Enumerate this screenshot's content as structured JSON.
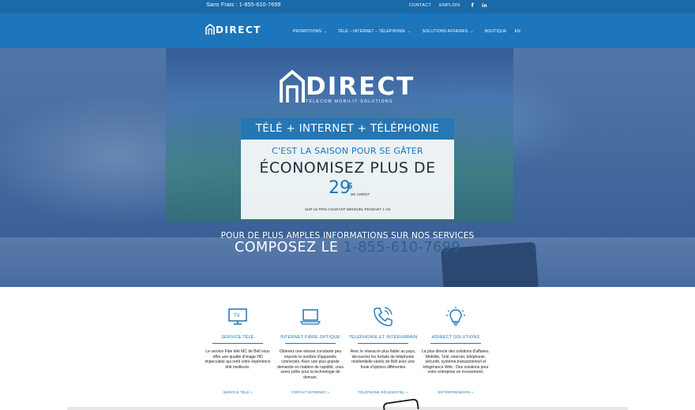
{
  "topbar": {
    "phone": "Sans Frais : 1-855-610-7699",
    "links": [
      "CONTACT",
      "EMPLOIS"
    ],
    "social": [
      "facebook-icon",
      "linkedin-icon"
    ],
    "social_glyphs": [
      "f",
      "in"
    ]
  },
  "nav": {
    "logo_text": "DIRECT",
    "items": [
      {
        "label": "PROMOTIONS",
        "dropdown": true
      },
      {
        "label": "TÉLÉ – INTERNET – TÉLÉPHONIE",
        "dropdown": true
      },
      {
        "label": "SOLUTIONS AFFAIRES",
        "dropdown": true
      },
      {
        "label": "BOUTIQUE",
        "dropdown": false
      },
      {
        "label": "EN",
        "dropdown": false
      }
    ]
  },
  "hero": {
    "logo_text": "DIRECT",
    "logo_tagline": "TÉLÉCOM MOBILIT SOLUTIONS",
    "band_title": "TÉLÉ + INTERNET + TÉLÉPHONIE",
    "promo": {
      "line1": "C'EST LA SAISON POUR SE GÂTER",
      "line2": "ÉCONOMISEZ PLUS DE",
      "amount": "29",
      "currency": "$",
      "credit": "DE CRÉDIT",
      "footnote": "SUR LE PRIX COURANT MENSUEL PENDANT 1 AN"
    },
    "info_line": "POUR DE PLUS AMPLES INFORMATIONS SUR NOS SERVICES",
    "call_prefix": "COMPOSEZ LE",
    "call_number": "1-855-610-7699"
  },
  "services": [
    {
      "icon": "tv-icon",
      "title": "SERVICE TÉLÉ",
      "desc": "Le service Fibe télé MC de Bell vous offre une qualité d'image HD impeccable qui rend votre expérience télé meilleure.",
      "link": "SERVICE TÉLÉ »"
    },
    {
      "icon": "laptop-icon",
      "title": "INTERNET FIBRE OPTIQUE",
      "desc": "Obtenez une vitesse constante peu importe le nombre d'appareils connectés. Avec une plus grande demande en matière de rapidité, vous serez prêts pour la technologie de demain.",
      "link": "FORFAIT INTERNET »"
    },
    {
      "icon": "phone-icon",
      "title": "TÉLÉPHONIE ET INTERURBAIN",
      "desc": "Avec le réseau le plus fiable au pays, découvrez les forfaits de téléphonie résidentielle variés de Bell avec une foule d'options différentes",
      "link": "TÉLÉPHONE RÉSIDENTIEL »"
    },
    {
      "icon": "lightbulb-icon",
      "title": "HDIRECT SOLUTIONS",
      "desc": "La plus directe des solutions d'affaires. Mobilité, Télé, internet, téléphonie, sécurité, système transactionnel et infogérance Web : Des solutions pour votre entreprise en mouvement.",
      "link": "ENTREPRENEURS »"
    }
  ],
  "colors": {
    "brand": "#1d75bb",
    "topbar": "#1a69a8",
    "hero_overlay": "#1e5096"
  }
}
